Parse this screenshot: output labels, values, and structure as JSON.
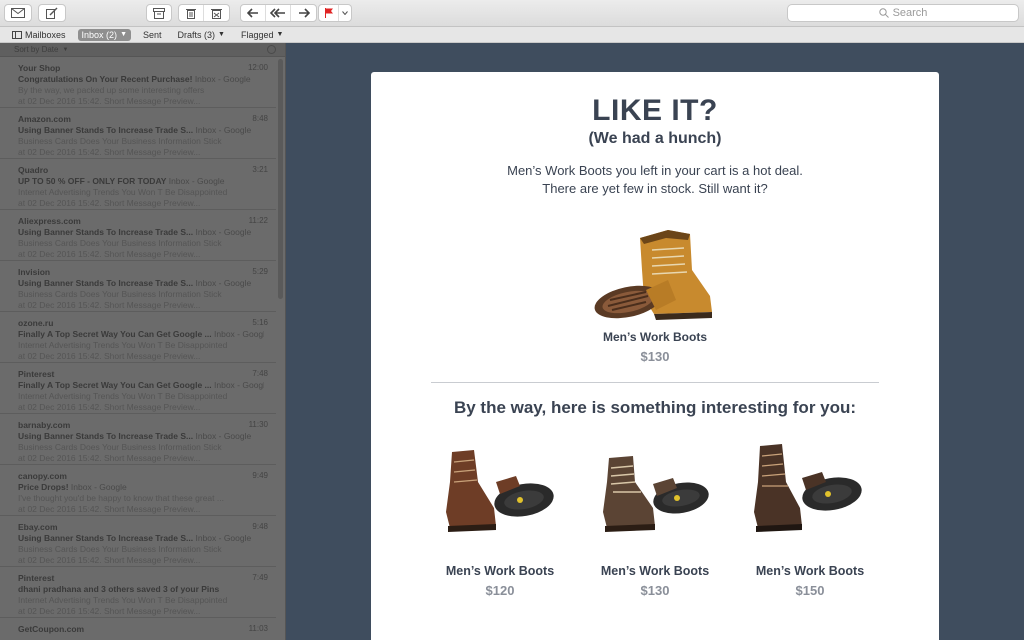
{
  "toolbar": {
    "search_placeholder": "Search"
  },
  "favorites": {
    "mailboxes": "Mailboxes",
    "inbox": "Inbox (2)",
    "sent": "Sent",
    "drafts": "Drafts (3)",
    "flagged": "Flagged"
  },
  "list": {
    "sort_label": "Sort by Date",
    "messages": [
      {
        "from": "Your Shop",
        "date": "12:00",
        "subject": "Congratulations On Your Recent Purchase!",
        "tag": "Inbox - Google",
        "line1": "By the way, we packed up some interesting offers",
        "line2": "at 02 Dec 2016 15:42. Short Message Preview..."
      },
      {
        "from": "Amazon.com",
        "date": "8:48",
        "subject": "Using Banner Stands To Increase Trade S...",
        "tag": "Inbox - Google",
        "line1": "Business Cards Does Your Business Information Stick",
        "line2": "at 02 Dec 2016 15:42. Short Message Preview..."
      },
      {
        "from": "Quadro",
        "date": "3:21",
        "subject": "UP TO 50 % OFF - ONLY FOR TODAY",
        "tag": "Inbox - Google",
        "line1": "Internet Advertising Trends You Won T Be Disappointed",
        "line2": "at 02 Dec 2016 15:42. Short Message Preview..."
      },
      {
        "from": "Aliexpress.com",
        "date": "11:22",
        "subject": "Using Banner Stands To Increase Trade S...",
        "tag": "Inbox - Google",
        "line1": "Business Cards Does Your Business Information Stick",
        "line2": "at 02 Dec 2016 15:42. Short Message Preview..."
      },
      {
        "from": "Invision",
        "date": "5:29",
        "subject": "Using Banner Stands To Increase Trade S...",
        "tag": "Inbox - Google",
        "line1": "Business Cards Does Your Business Information Stick",
        "line2": "at 02 Dec 2016 15:42. Short Message Preview..."
      },
      {
        "from": "ozone.ru",
        "date": "5:16",
        "subject": "Finally A Top Secret Way You Can Get Google ...",
        "tag": "Inbox - Google",
        "line1": "Internet Advertising Trends You Won T Be Disappointed",
        "line2": "at 02 Dec 2016 15:42. Short Message Preview..."
      },
      {
        "from": "Pinterest",
        "date": "7:48",
        "subject": "Finally A Top Secret Way You Can Get Google ...",
        "tag": "Inbox - Google",
        "line1": "Internet Advertising Trends You Won T Be Disappointed",
        "line2": "at 02 Dec 2016 15:42. Short Message Preview..."
      },
      {
        "from": "barnaby.com",
        "date": "11:30",
        "subject": "Using Banner Stands To Increase Trade S...",
        "tag": "Inbox - Google",
        "line1": "Business Cards Does Your Business Information Stick",
        "line2": "at 02 Dec 2016 15:42. Short Message Preview..."
      },
      {
        "from": "canopy.com",
        "date": "9:49",
        "subject": "Price Drops!",
        "tag": "Inbox - Google",
        "line1": "I've thought you'd be happy to know that these great ...",
        "line2": "at 02 Dec 2016 15:42. Short Message Preview..."
      },
      {
        "from": "Ebay.com",
        "date": "9:48",
        "subject": "Using Banner Stands To Increase Trade S...",
        "tag": "Inbox - Google",
        "line1": "Business Cards Does Your Business Information Stick",
        "line2": "at 02 Dec 2016 15:42. Short Message Preview..."
      },
      {
        "from": "Pinterest",
        "date": "7:49",
        "subject": "dhani pradhana and 3 others saved 3 of your Pins",
        "tag": "",
        "line1": "Internet Advertising Trends You Won T Be Disappointed",
        "line2": "at 02 Dec 2016 15:42. Short Message Preview..."
      },
      {
        "from": "GetCoupon.com",
        "date": "11:03",
        "subject": "",
        "tag": "",
        "line1": "",
        "line2": ""
      }
    ]
  },
  "email": {
    "headline": "LIKE IT?",
    "subheadline": "(We had a hunch)",
    "intro_line1": "Men’s Work Boots you left in your cart is a hot deal.",
    "intro_line2": "There are yet few in stock. Still want it?",
    "hero_product": {
      "name": "Men’s Work Boots",
      "price": "$130"
    },
    "section_title": "By the way, here is something interesting for you:",
    "products": [
      {
        "name": "Men’s Work Boots",
        "price": "$120"
      },
      {
        "name": "Men’s Work Boots",
        "price": "$130"
      },
      {
        "name": "Men’s Work Boots",
        "price": "$150"
      }
    ]
  },
  "icons": {
    "compose": "compose-icon",
    "get_mail": "envelope-icon",
    "archive": "archive-icon",
    "delete": "trash-icon",
    "junk": "junk-icon",
    "reply": "reply-icon",
    "reply_all": "reply-all-icon",
    "forward": "forward-icon",
    "flag": "flag-icon"
  },
  "colors": {
    "flag": "#e02424",
    "sidebar_bg": "#6b6b6b",
    "content_bg": "#3f4d5e"
  }
}
